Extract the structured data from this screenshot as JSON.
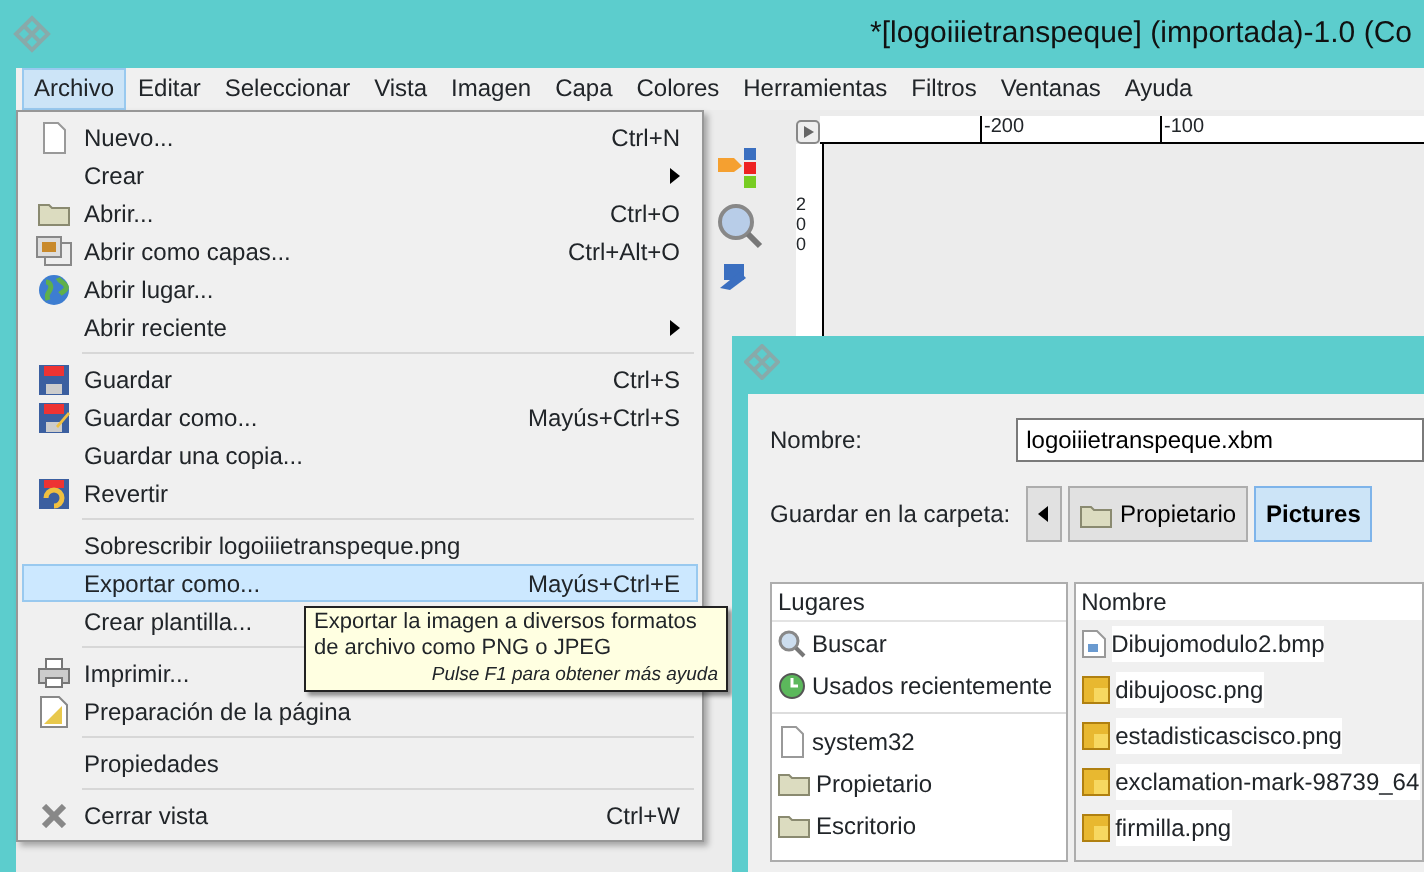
{
  "window": {
    "title": "*[logoiiietranspeque] (importada)-1.0 (Co"
  },
  "menubar": [
    {
      "label": "Archivo",
      "selected": true
    },
    {
      "label": "Editar",
      "selected": false
    },
    {
      "label": "Seleccionar",
      "selected": false
    },
    {
      "label": "Vista",
      "selected": false
    },
    {
      "label": "Imagen",
      "selected": false
    },
    {
      "label": "Capa",
      "selected": false
    },
    {
      "label": "Colores",
      "selected": false
    },
    {
      "label": "Herramientas",
      "selected": false
    },
    {
      "label": "Filtros",
      "selected": false
    },
    {
      "label": "Ventanas",
      "selected": false
    },
    {
      "label": "Ayuda",
      "selected": false
    }
  ],
  "rulers": {
    "horizontal": [
      "-200",
      "-100"
    ],
    "vertical": "200"
  },
  "file_menu": [
    {
      "kind": "item",
      "label": "Nuevo...",
      "shortcut": "Ctrl+N",
      "submenu": false,
      "selected": false
    },
    {
      "kind": "item",
      "label": "Crear",
      "submenu": true,
      "selected": false
    },
    {
      "kind": "item",
      "label": "Abrir...",
      "shortcut": "Ctrl+O",
      "submenu": false,
      "selected": false
    },
    {
      "kind": "item",
      "label": "Abrir como capas...",
      "shortcut": "Ctrl+Alt+O",
      "submenu": false,
      "selected": false
    },
    {
      "kind": "item",
      "label": "Abrir lugar...",
      "submenu": false,
      "selected": false
    },
    {
      "kind": "item",
      "label": "Abrir reciente",
      "submenu": true,
      "selected": false
    },
    {
      "kind": "separator"
    },
    {
      "kind": "item",
      "label": "Guardar",
      "shortcut": "Ctrl+S",
      "submenu": false,
      "selected": false
    },
    {
      "kind": "item",
      "label": "Guardar como...",
      "shortcut": "Mayús+Ctrl+S",
      "submenu": false,
      "selected": false
    },
    {
      "kind": "item",
      "label": "Guardar una copia...",
      "submenu": false,
      "selected": false
    },
    {
      "kind": "item",
      "label": "Revertir",
      "submenu": false,
      "selected": false
    },
    {
      "kind": "separator"
    },
    {
      "kind": "item",
      "label": "Sobrescribir logoiiietranspeque.png",
      "submenu": false,
      "selected": false
    },
    {
      "kind": "item",
      "label": "Exportar como...",
      "shortcut": "Mayús+Ctrl+E",
      "submenu": false,
      "selected": true
    },
    {
      "kind": "item",
      "label": "Crear plantilla...",
      "submenu": false,
      "selected": false
    },
    {
      "kind": "separator"
    },
    {
      "kind": "item",
      "label": "Imprimir...",
      "submenu": false,
      "selected": false
    },
    {
      "kind": "item",
      "label": "Preparación de la página",
      "submenu": false,
      "selected": false
    },
    {
      "kind": "separator"
    },
    {
      "kind": "item",
      "label": "Propiedades",
      "submenu": false,
      "selected": false
    },
    {
      "kind": "separator"
    },
    {
      "kind": "item",
      "label": "Cerrar vista",
      "shortcut": "Ctrl+W",
      "submenu": false,
      "selected": false
    }
  ],
  "tooltip": {
    "text": "Exportar la imagen a diversos formatos de archivo como PNG o JPEG",
    "hint": "Pulse F1 para obtener más ayuda"
  },
  "dialog": {
    "name_label": "Nombre:",
    "name_value": "logoiiietranspeque.xbm",
    "folder_label": "Guardar en la carpeta:",
    "path": [
      {
        "label": "Propietario",
        "selected": false
      },
      {
        "label": "Pictures",
        "selected": true
      }
    ],
    "places_header": "Lugares",
    "places": [
      {
        "kind": "item",
        "label": "Buscar"
      },
      {
        "kind": "item",
        "label": "Usados recientemente"
      },
      {
        "kind": "separator"
      },
      {
        "kind": "item",
        "label": "system32"
      },
      {
        "kind": "item",
        "label": "Propietario"
      },
      {
        "kind": "item",
        "label": "Escritorio"
      }
    ],
    "files_header": "Nombre",
    "files": [
      "Dibujomodulo2.bmp",
      "dibujoosc.png",
      "estadisticascisco.png",
      "exclamation-mark-98739_64",
      "firmilla.png"
    ]
  }
}
